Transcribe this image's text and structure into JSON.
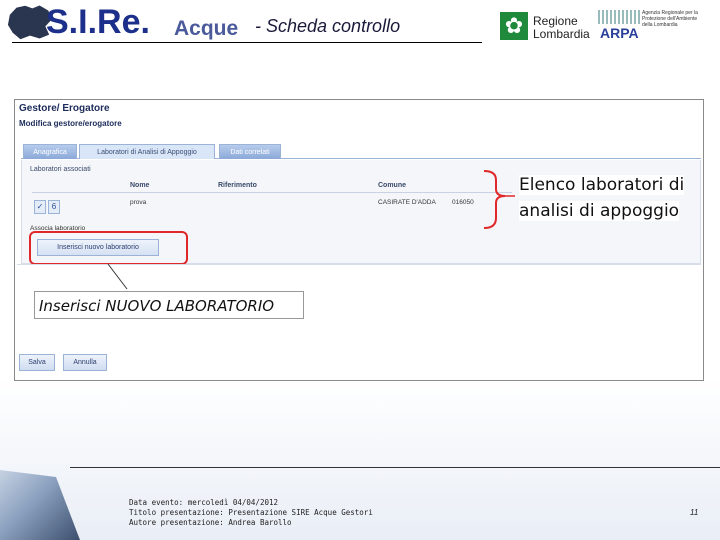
{
  "header": {
    "logo_main": "S.I.Re.",
    "logo_sub": "Acque",
    "title": "-  Scheda controllo",
    "region_logo_line1": "Regione",
    "region_logo_line2": "Lombardia",
    "arpa_label": "ARPA",
    "arpa_agency": "Agenzia Regionale per la Protezione dell'Ambiente della Lombardia"
  },
  "panel": {
    "title": "Gestore/ Erogatore",
    "subtitle": "Modifica gestore/erogatore",
    "tabs": [
      "Anagrafica",
      "Laboratori di Analisi di Appoggio",
      "Dati correlati"
    ],
    "active_tab": 1,
    "section_title": "Laboratori associati",
    "columns": [
      "Nome",
      "Riferimento",
      "Comune"
    ],
    "rows": [
      {
        "nome": "prova",
        "riferimento": "",
        "comune": "CASIRATE D'ADDA",
        "codice": "016050"
      }
    ],
    "association_label": "Associa laboratorio",
    "insert_button": "Inserisci nuovo laboratorio",
    "save_button": "Salva",
    "cancel_button": "Annulla"
  },
  "callouts": {
    "right_line1": "Elenco laboratori di",
    "right_line2": "analisi di appoggio",
    "left": "Inserisci NUOVO LABORATORIO"
  },
  "footer": {
    "line1": "Data evento: mercoledì 04/04/2012",
    "line2": "Titolo presentazione: Presentazione SIRE Acque Gestori",
    "line3": "Autore presentazione: Andrea Barollo",
    "page_number": "11"
  },
  "colors": {
    "highlight": "#e0282a",
    "brand_blue": "#1c2f8a",
    "tab_blue": "#8aa8d8"
  }
}
